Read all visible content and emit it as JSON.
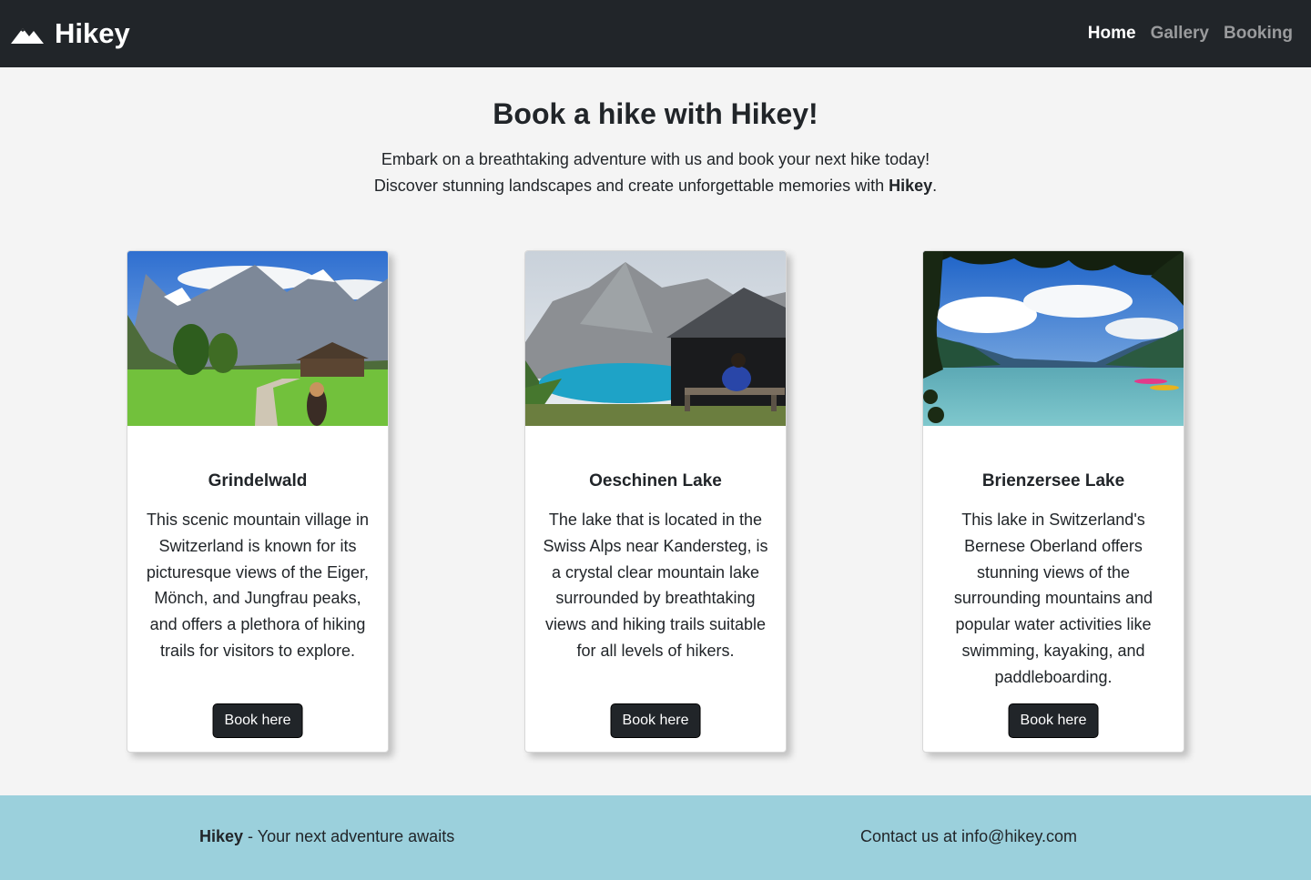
{
  "navbar": {
    "brand_icon": "mountain-icon",
    "brand_name": "Hikey",
    "links": [
      {
        "label": "Home",
        "active": true
      },
      {
        "label": "Gallery",
        "active": false
      },
      {
        "label": "Booking",
        "active": false
      }
    ]
  },
  "hero": {
    "title": "Book a hike with Hikey!",
    "line1": "Embark on a breathtaking adventure with us and book your next hike today!",
    "line2_prefix": "Discover stunning landscapes and create unforgettable memories with ",
    "line2_bold": "Hikey",
    "line2_suffix": "."
  },
  "cards": [
    {
      "image": "grindelwald-photo",
      "title": "Grindelwald",
      "text": "This scenic mountain village in Switzerland is known for its picturesque views of the Eiger, Mönch, and Jungfrau peaks, and offers a plethora of hiking trails for visitors to explore.",
      "button": "Book here"
    },
    {
      "image": "oeschinen-lake-photo",
      "title": "Oeschinen Lake",
      "text": "The lake that is located in the Swiss Alps near Kandersteg, is a crystal clear mountain lake surrounded by breathtaking views and hiking trails suitable for all levels of hikers.",
      "button": "Book here"
    },
    {
      "image": "brienzersee-lake-photo",
      "title": "Brienzersee Lake",
      "text": "This lake in Switzerland's Bernese Oberland offers stunning views of the surrounding mountains and popular water activities like swimming, kayaking, and paddleboarding.",
      "button": "Book here"
    }
  ],
  "footer": {
    "brand": "Hikey",
    "tagline": " - Your next adventure awaits",
    "contact": "Contact us at info@hikey.com"
  },
  "colors": {
    "navbar_bg": "#212529",
    "page_bg": "#f4f4f4",
    "footer_bg": "#9bd0dc",
    "button_bg": "#212529",
    "nav_inactive": "#9a9b9d"
  }
}
